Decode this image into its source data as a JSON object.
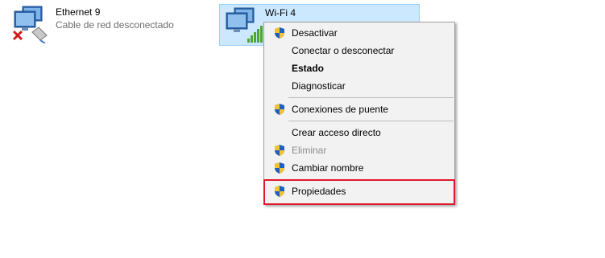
{
  "adapters": [
    {
      "name": "Ethernet 9",
      "status": "Cable de red desconectado"
    },
    {
      "name": "Wi-Fi 4"
    }
  ],
  "context_menu": {
    "items": [
      {
        "label": "Desactivar",
        "shield": true
      },
      {
        "label": "Conectar o desconectar",
        "shield": false
      },
      {
        "label": "Estado",
        "shield": false,
        "bold": true
      },
      {
        "label": "Diagnosticar",
        "shield": false
      },
      {
        "label": "Conexiones de puente",
        "shield": true
      },
      {
        "label": "Crear acceso directo",
        "shield": false
      },
      {
        "label": "Eliminar",
        "shield": true,
        "disabled": true
      },
      {
        "label": "Cambiar nombre",
        "shield": true
      },
      {
        "label": "Propiedades",
        "shield": true,
        "highlighted": true
      }
    ]
  },
  "colors": {
    "selection_bg": "#cce8ff",
    "selection_border": "#99d1ff",
    "highlight_box": "#e0182d",
    "menu_bg": "#f2f2f2",
    "shield_blue": "#1f5fbf",
    "shield_yellow": "#f2c230"
  }
}
